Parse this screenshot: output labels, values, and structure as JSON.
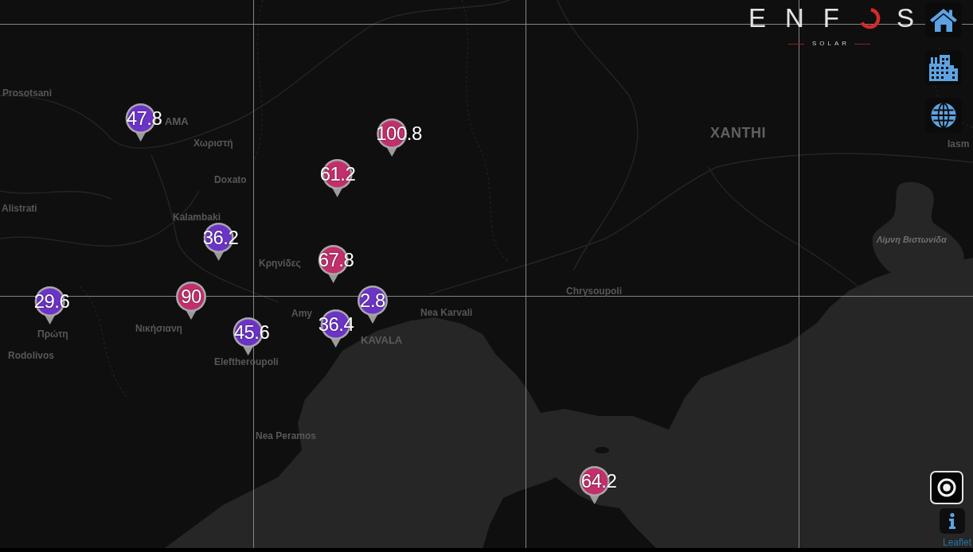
{
  "logo": {
    "letters_before": "ENF",
    "letters_after": "S",
    "tagline": "SOLAR"
  },
  "map": {
    "labels": [
      {
        "text": "Prosotsani",
        "kind": "small"
      },
      {
        "text": "AMA",
        "kind": "medium"
      },
      {
        "text": "XANTHI",
        "kind": "large"
      },
      {
        "text": "Χωριστή",
        "kind": "small"
      },
      {
        "text": "Iasm",
        "kind": "small"
      },
      {
        "text": "Doxato",
        "kind": "small"
      },
      {
        "text": "Alistrati",
        "kind": "small"
      },
      {
        "text": "Kalambaki",
        "kind": "small"
      },
      {
        "text": "Λίμνη Βιστωνίδα",
        "kind": "water"
      },
      {
        "text": "Κρηνίδες",
        "kind": "small"
      },
      {
        "text": "Chrysoupoli",
        "kind": "small"
      },
      {
        "text": "Nea Karvali",
        "kind": "small"
      },
      {
        "text": "Amy",
        "kind": "small"
      },
      {
        "text": "Νικήσιανη",
        "kind": "small"
      },
      {
        "text": "Πρώτη",
        "kind": "small"
      },
      {
        "text": "KAVALA",
        "kind": "medium"
      },
      {
        "text": "Rodolivos",
        "kind": "small"
      },
      {
        "text": "Eleftheroupoli",
        "kind": "small"
      },
      {
        "text": "Nea Peramos",
        "kind": "small"
      }
    ],
    "markers": [
      {
        "value": "47.8",
        "color": "#6b34c6"
      },
      {
        "value": "100.8",
        "color": "#c2306c"
      },
      {
        "value": "61.2",
        "color": "#c2306c"
      },
      {
        "value": "36.2",
        "color": "#6b34c6"
      },
      {
        "value": "67.8",
        "color": "#c2306c"
      },
      {
        "value": "29.6",
        "color": "#6b34c6"
      },
      {
        "value": "90",
        "color": "#c2306c"
      },
      {
        "value": "2.8",
        "color": "#6b34c6"
      },
      {
        "value": "36.4",
        "color": "#6b34c6"
      },
      {
        "value": "45.6",
        "color": "#6b34c6"
      },
      {
        "value": "64.2",
        "color": "#c2306c"
      }
    ]
  },
  "attribution": "Leaflet"
}
